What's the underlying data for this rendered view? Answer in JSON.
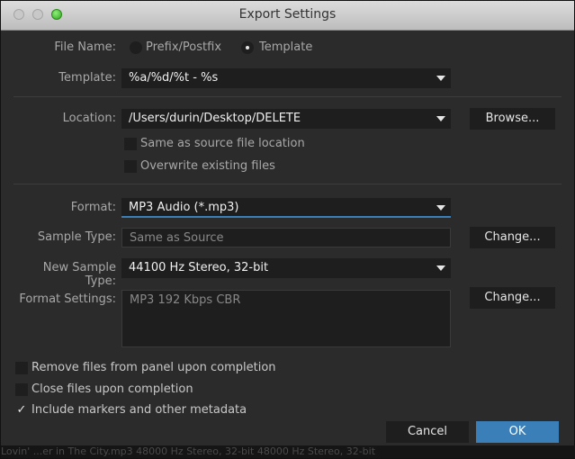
{
  "window": {
    "title": "Export Settings"
  },
  "file_name": {
    "label": "File Name:",
    "options": [
      {
        "label": "Prefix/Postfix",
        "selected": false
      },
      {
        "label": "Template",
        "selected": true
      }
    ]
  },
  "template": {
    "label": "Template:",
    "value": "%a/%d/%t - %s"
  },
  "location": {
    "label": "Location:",
    "value": "/Users/durin/Desktop/DELETE",
    "browse_label": "Browse...",
    "same_as_source": {
      "label": "Same as source file location",
      "checked": false
    },
    "overwrite": {
      "label": "Overwrite existing files",
      "checked": false
    }
  },
  "format": {
    "label": "Format:",
    "value": "MP3 Audio (*.mp3)"
  },
  "sample_type": {
    "label": "Sample Type:",
    "value": "Same as Source",
    "change_label": "Change..."
  },
  "new_sample_type": {
    "label": "New Sample Type:",
    "value": "44100 Hz Stereo, 32-bit"
  },
  "format_settings": {
    "label": "Format Settings:",
    "value": "MP3 192 Kbps CBR",
    "change_label": "Change..."
  },
  "options": [
    {
      "label": "Remove files from panel upon completion",
      "checked": false
    },
    {
      "label": "Close files upon completion",
      "checked": false
    },
    {
      "label": "Include markers and other metadata",
      "checked": true
    }
  ],
  "footer": {
    "cancel_label": "Cancel",
    "ok_label": "OK"
  },
  "background_strip": {
    "text": "Lovin' ...er in The City.mp3                                                   48000 Hz Stereo, 32-bit   48000 Hz Stereo, 32-bit"
  },
  "colors": {
    "accent": "#3b7fb8",
    "background": "#2b2b2b",
    "field": "#1e1e1e",
    "label": "#a8a8a8",
    "text": "#e6e6e6"
  },
  "icons": {
    "dropdown": "chevron-down-icon",
    "checkmark": "check-icon"
  }
}
